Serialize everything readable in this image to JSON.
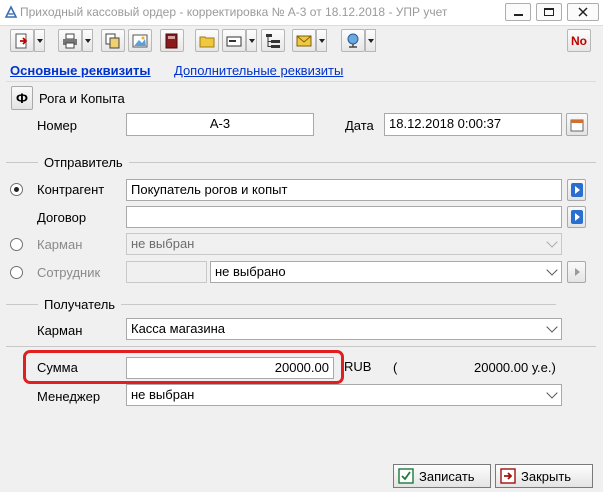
{
  "window": {
    "title": "Приходный кассовый ордер - корректировка № А-3 от 18.12.2018 - УПР учет"
  },
  "toolbar": {
    "right_icon_text": "No"
  },
  "tabs": [
    {
      "label": "Основные реквизиты"
    },
    {
      "label": "Дополнительные реквизиты"
    }
  ],
  "org": {
    "icon_letter": "Ф",
    "name": "Рога и Копыта"
  },
  "header": {
    "number_label": "Номер",
    "number_value": "А-3",
    "date_label": "Дата",
    "date_value": "18.12.2018 0:00:37"
  },
  "sender": {
    "group_label": "Отправитель",
    "counterparty_label": "Контрагент",
    "counterparty_value": "Покупатель рогов и копыт",
    "contract_label": "Договор",
    "contract_value": "",
    "pocket_label": "Карман",
    "pocket_value": "не выбран",
    "employee_label": "Сотрудник",
    "employee_value": "не выбрано",
    "selected": "counterparty"
  },
  "receiver": {
    "group_label": "Получатель",
    "pocket_label": "Карман",
    "pocket_value": "Касса магазина"
  },
  "amount": {
    "label": "Сумма",
    "value": "20000.00",
    "currency": "RUB",
    "paren_open": "(",
    "ue_value": "20000.00 у.е.)"
  },
  "manager": {
    "label": "Менеджер",
    "value": "не выбран"
  },
  "buttons": {
    "save": "Записать",
    "close": "Закрыть"
  },
  "colors": {
    "link": "#0033cc",
    "highlight": "#e02020",
    "toolbar_red": "#c00000"
  }
}
